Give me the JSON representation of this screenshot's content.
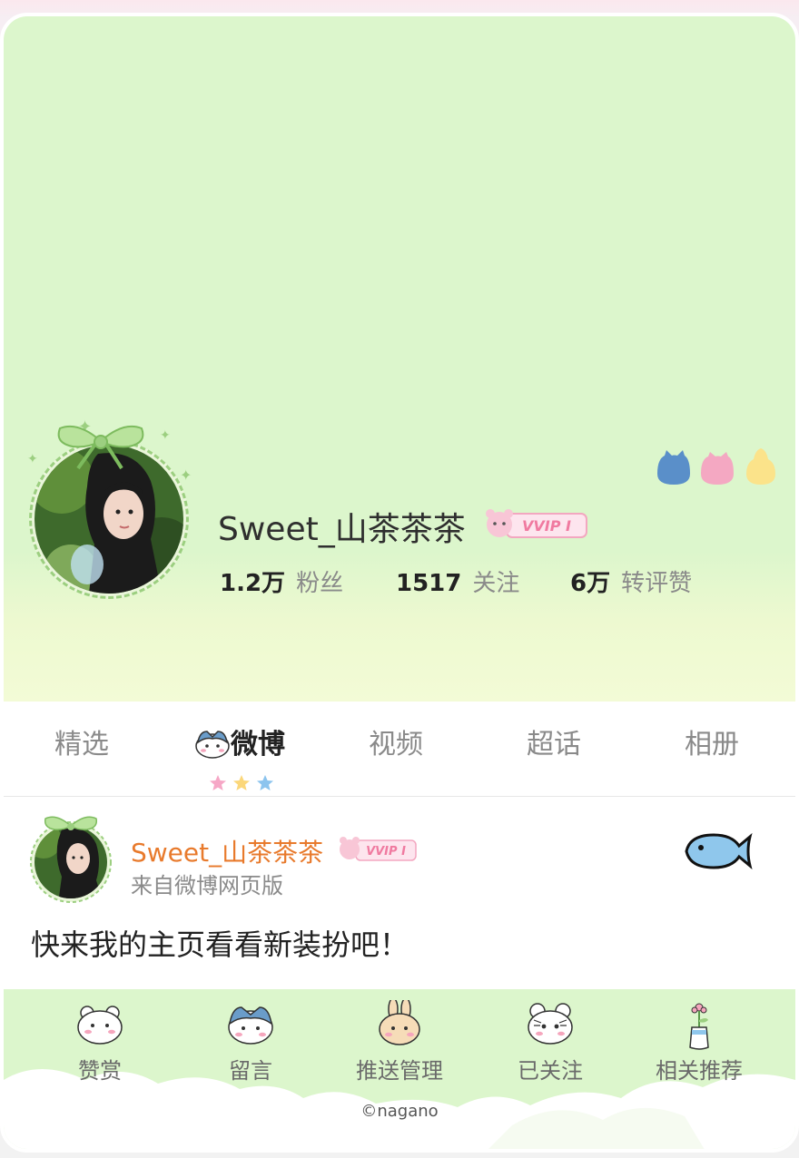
{
  "profile": {
    "username": "Sweet_山茶茶茶",
    "vip_label": "VVIP I",
    "stats": [
      {
        "num": "1.2万",
        "label": "粉丝"
      },
      {
        "num": "1517",
        "label": "关注"
      },
      {
        "num": "6万",
        "label": "转评赞"
      }
    ]
  },
  "tabs": [
    {
      "label": "精选"
    },
    {
      "label": "微博"
    },
    {
      "label": "视频"
    },
    {
      "label": "超话"
    },
    {
      "label": "相册"
    }
  ],
  "post": {
    "author": "Sweet_山茶茶茶",
    "vip_label": "VVIP I",
    "source": "来自微博网页版",
    "text": "快来我的主页看看新装扮吧！"
  },
  "actions": [
    {
      "label": "赞赏",
      "icon": "bear-icon"
    },
    {
      "label": "留言",
      "icon": "hachiware-icon"
    },
    {
      "label": "推送管理",
      "icon": "usagi-icon"
    },
    {
      "label": "已关注",
      "icon": "momonga-icon"
    },
    {
      "label": "相关推荐",
      "icon": "flower-vase-icon"
    }
  ],
  "footer": {
    "copyright": "©nagano"
  },
  "colors": {
    "header_green": "#dcf6cc",
    "author_orange": "#e87a2c",
    "vip_pink": "#f07aa0"
  }
}
